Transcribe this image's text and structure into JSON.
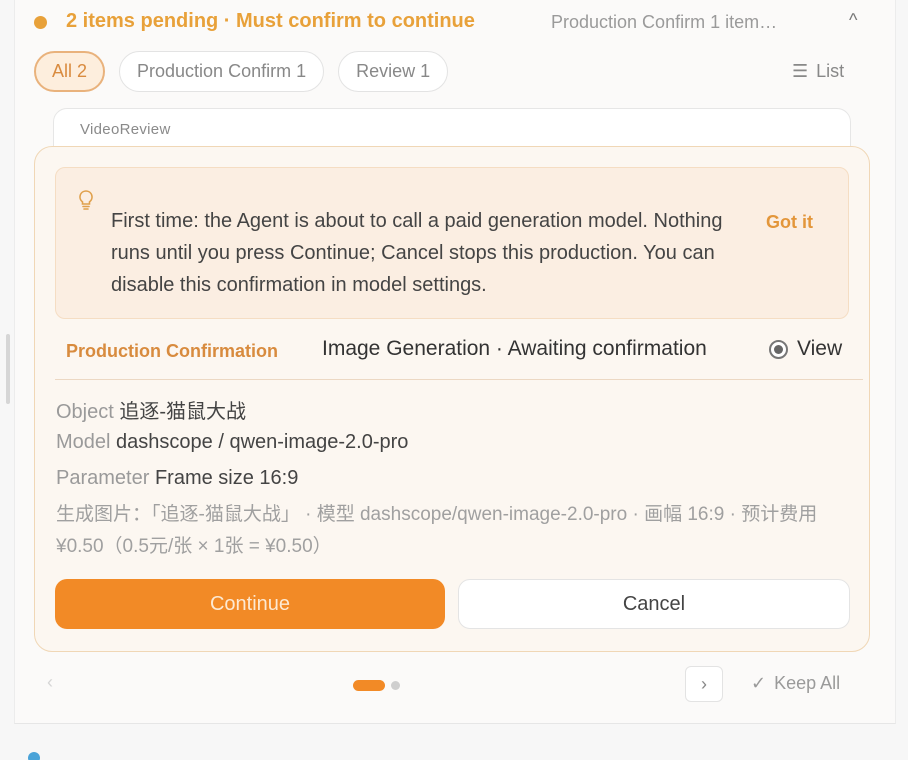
{
  "header": {
    "title": "2 items pending · Must confirm to continue",
    "subtitle": "Production Confirm 1 item…",
    "collapse_icon": "^"
  },
  "filters": [
    {
      "label": "All 2",
      "active": true
    },
    {
      "label": "Production Confirm 1",
      "active": false
    },
    {
      "label": "Review 1",
      "active": false
    }
  ],
  "list_toggle": {
    "icon": "☰",
    "label": "List"
  },
  "tab_card": {
    "label": "VideoReview"
  },
  "notice": {
    "icon": "lightbulb-icon",
    "text": "First time: the Agent is about to call a paid generation model. Nothing runs until you press Continue; Cancel stops this production. You can disable this confirmation in model settings.",
    "dismiss_label": "Got it"
  },
  "section": {
    "label": "Production Confirmation",
    "status": "Image Generation · Awaiting confirmation",
    "view_label": "View"
  },
  "details": {
    "object_key": "Object",
    "object_value": "追逐-猫鼠大战",
    "model_key": "Model",
    "model_value": "dashscope / qwen-image-2.0-pro",
    "param_key": "Parameter",
    "param_value": "Frame size 16:9",
    "description": "生成图片：「追逐-猫鼠大战」 · 模型 dashscope/qwen-image-2.0-pro · 画幅 16:9 · 预计费用 ¥0.50（0.5元/张 × 1张 = ¥0.50）"
  },
  "actions": {
    "continue_label": "Continue",
    "cancel_label": "Cancel"
  },
  "pager": {
    "prev": "‹",
    "next": "›",
    "current": 1,
    "total": 2
  },
  "keep_all": {
    "icon": "✓",
    "label": "Keep All"
  },
  "colors": {
    "accent": "#f28a26",
    "pending": "#e8a13a",
    "notice_bg": "#fbeee2"
  }
}
